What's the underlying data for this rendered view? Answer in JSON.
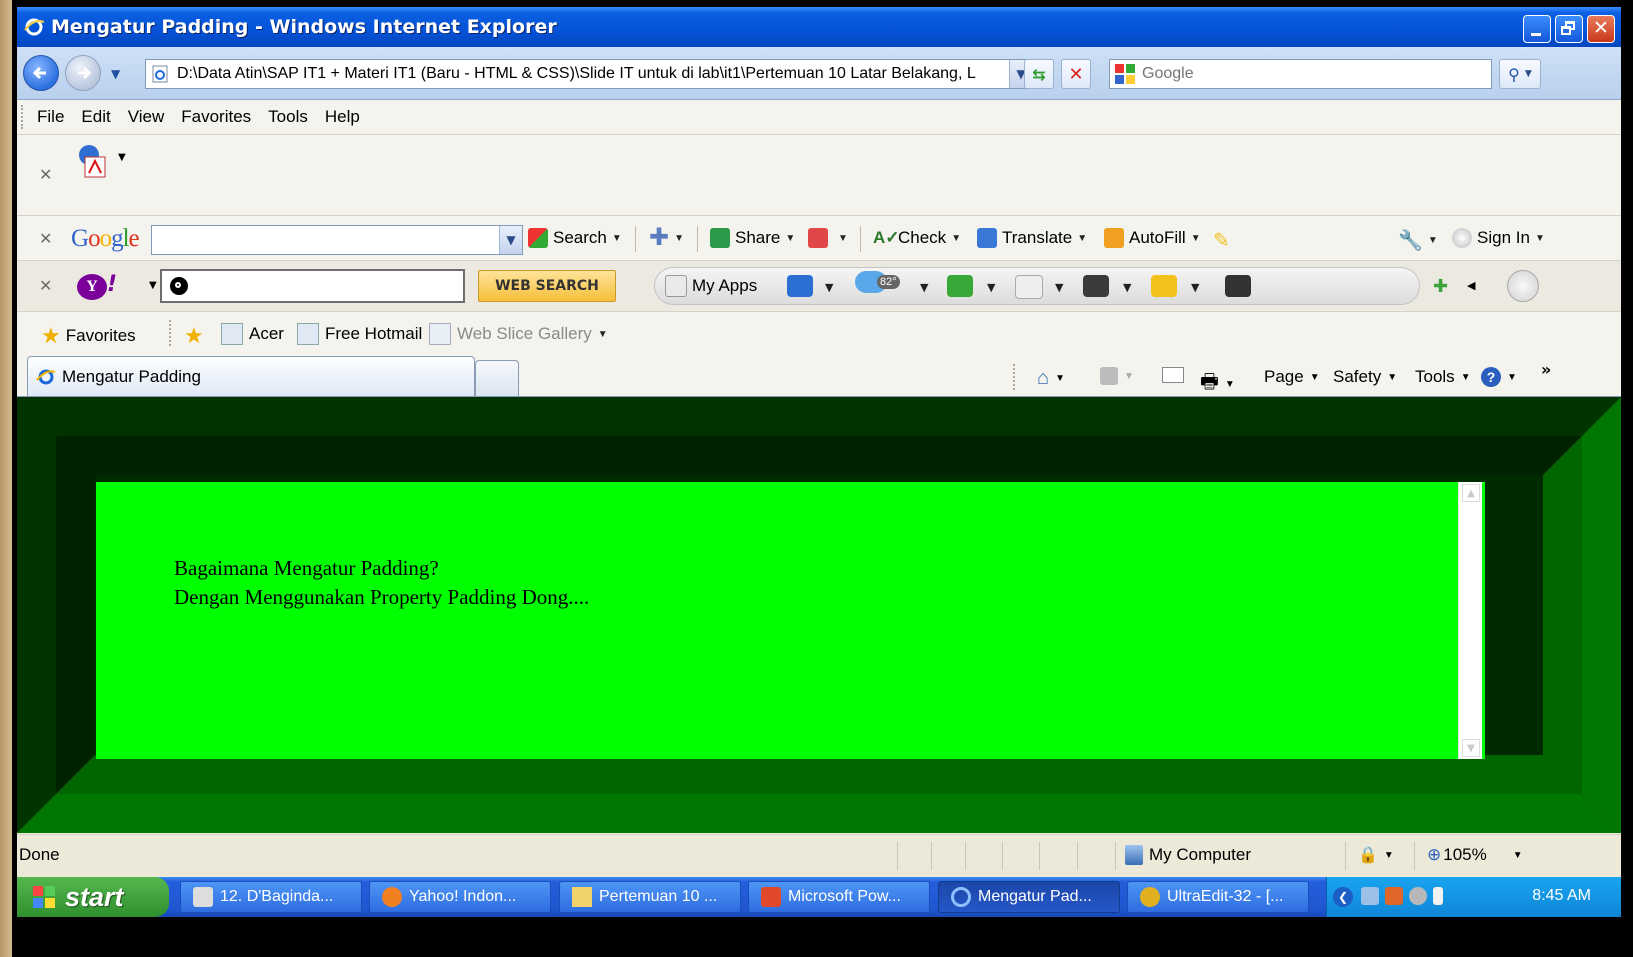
{
  "window": {
    "title": "Mengatur Padding - Windows Internet Explorer"
  },
  "address_bar": {
    "url": "D:\\Data Atin\\SAP IT1 + Materi IT1 (Baru - HTML & CSS)\\Slide IT untuk di lab\\it1\\Pertemuan 10 Latar Belakang, L",
    "search_placeholder": "Google"
  },
  "menu": [
    "File",
    "Edit",
    "View",
    "Favorites",
    "Tools",
    "Help"
  ],
  "google_toolbar": {
    "logo": "Google",
    "search_label": "Search",
    "share_label": "Share",
    "check_label": "Check",
    "translate_label": "Translate",
    "autofill_label": "AutoFill",
    "signin_label": "Sign In"
  },
  "yahoo_toolbar": {
    "logo": "Y!",
    "web_search_label": "WEB SEARCH",
    "my_apps_label": "My Apps",
    "weather_temp": "82°"
  },
  "favorites_bar": {
    "favorites_label": "Favorites",
    "items": [
      "Acer",
      "Free Hotmail",
      "Web Slice Gallery"
    ]
  },
  "tabs": {
    "active_tab": "Mengatur Padding"
  },
  "command_bar": {
    "page_label": "Page",
    "safety_label": "Safety",
    "tools_label": "Tools",
    "overflow": "»"
  },
  "content": {
    "line1": "Bagaimana Mengatur Padding?",
    "line2": "Dengan Menggunakan Property Padding Dong....",
    "colors": {
      "outer_border": "#003300",
      "inner_border": "#006600",
      "box_background": "#00ff00"
    }
  },
  "status_bar": {
    "status": "Done",
    "zone": "My Computer",
    "zoom": "105%"
  },
  "taskbar": {
    "start_label": "start",
    "tasks": [
      "12. D'Baginda...",
      "Yahoo! Indon...",
      "Pertemuan 10 ...",
      "Microsoft Pow...",
      "Mengatur Pad...",
      "UltraEdit-32 - [..."
    ],
    "clock": "8:45 AM"
  }
}
